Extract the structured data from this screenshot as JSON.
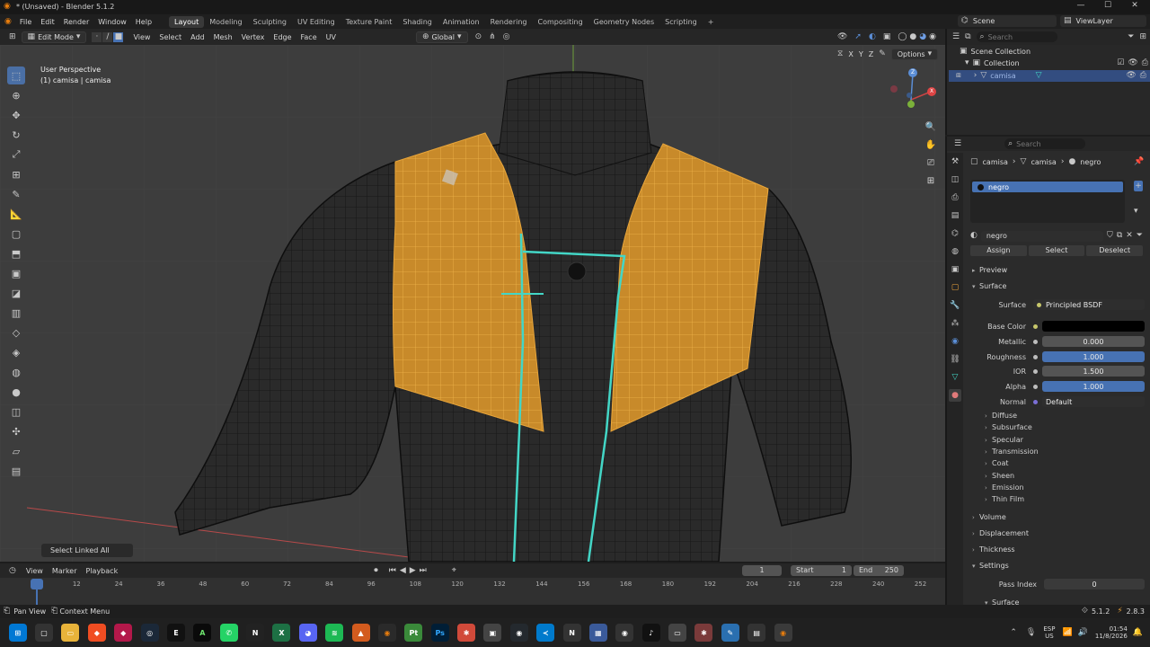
{
  "titlebar": {
    "title": "* (Unsaved) - Blender 5.1.2",
    "min": "—",
    "max": "☐",
    "close": "✕"
  },
  "menu": {
    "items": [
      "File",
      "Edit",
      "Render",
      "Window",
      "Help"
    ],
    "workspaces": [
      "Layout",
      "Modeling",
      "Sculpting",
      "UV Editing",
      "Texture Paint",
      "Shading",
      "Animation",
      "Rendering",
      "Compositing",
      "Geometry Nodes",
      "Scripting"
    ],
    "add_ws": "+",
    "scene": "Scene",
    "view_layer": "ViewLayer"
  },
  "viewport_header": {
    "mode": "Edit Mode",
    "menus": [
      "View",
      "Select",
      "Add",
      "Mesh",
      "Vertex",
      "Edge",
      "Face",
      "UV"
    ],
    "orientation": "Global",
    "options": "Options",
    "axes": [
      "X",
      "Y",
      "Z"
    ]
  },
  "viewport": {
    "perspective": "User Perspective",
    "object_info": "(1) camisa | camisa",
    "last_op": "Select Linked All"
  },
  "gizmo": {
    "x": "X",
    "y": "Y",
    "z": "Z"
  },
  "timeline": {
    "menus": [
      "View",
      "Marker",
      "Playback"
    ],
    "current_frame": "1",
    "start_label": "Start",
    "start": "1",
    "end_label": "End",
    "end": "250",
    "ticks": [
      "0",
      "12",
      "24",
      "36",
      "48",
      "60",
      "72",
      "84",
      "96",
      "108",
      "120",
      "132",
      "144",
      "156",
      "168",
      "180",
      "192",
      "204",
      "216",
      "228",
      "240",
      "252"
    ]
  },
  "status": {
    "pan": "Pan View",
    "context": "Context Menu",
    "version": "5.1.2",
    "fps": "2.8.3"
  },
  "outliner": {
    "search": "Search",
    "scene_collection": "Scene Collection",
    "collection": "Collection",
    "object": "camisa"
  },
  "props": {
    "search": "Search",
    "breadcrumb": [
      "camisa",
      "camisa",
      "negro"
    ],
    "slot": "negro",
    "material": "negro",
    "assign": "Assign",
    "select": "Select",
    "deselect": "Deselect",
    "preview": "Preview",
    "surface_panel": "Surface",
    "surface_label": "Surface",
    "surface_value": "Principled BSDF",
    "base_color_label": "Base Color",
    "base_color": "#000000",
    "metallic_label": "Metallic",
    "metallic": "0.000",
    "roughness_label": "Roughness",
    "roughness": "1.000",
    "ior_label": "IOR",
    "ior": "1.500",
    "alpha_label": "Alpha",
    "alpha": "1.000",
    "normal_label": "Normal",
    "normal": "Default",
    "subpanels": [
      "Diffuse",
      "Subsurface",
      "Specular",
      "Transmission",
      "Coat",
      "Sheen",
      "Emission",
      "Thin Film"
    ],
    "volume": "Volume",
    "displacement": "Displacement",
    "thickness": "Thickness",
    "settings": "Settings",
    "pass_index_label": "Pass Index",
    "pass_index": "0",
    "surface2": "Surface"
  },
  "taskbar": {
    "tray_lang": "ESP",
    "tray_region": "US",
    "time": "01:54",
    "date": "11/8/2026"
  },
  "colors": {
    "accent": "#4772b3",
    "selected_faces": "#d4942b",
    "seam": "#43d6c6",
    "viewport_bg": "#3d3d3d"
  }
}
